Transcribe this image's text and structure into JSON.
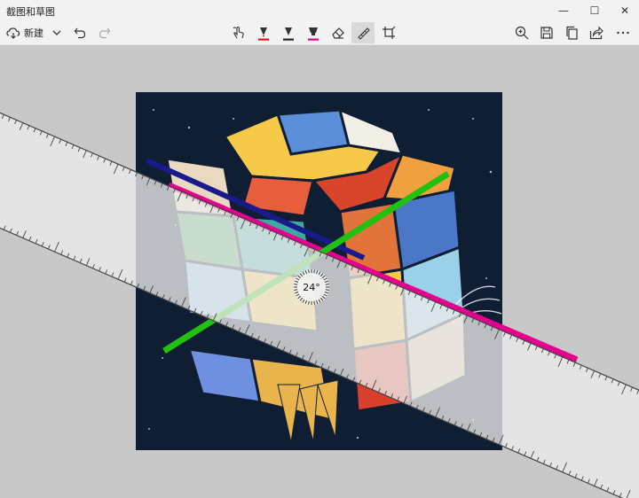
{
  "app": {
    "title": "截图和草图"
  },
  "window_controls": {
    "minimize": "—",
    "maximize": "☐",
    "close": "✕"
  },
  "toolbar": {
    "new_label": "新建",
    "icons": [
      "new-icon",
      "chevron-down-icon",
      "undo-icon",
      "redo-icon",
      "touch-writing-icon",
      "ballpoint-pen-icon",
      "pencil-icon",
      "highlighter-icon",
      "eraser-icon",
      "ruler-icon",
      "crop-icon",
      "zoom-icon",
      "save-icon",
      "copy-icon",
      "share-icon",
      "more-icon"
    ]
  },
  "ruler": {
    "angle_label": "24°",
    "angle_degrees": 24
  },
  "colors": {
    "pen_red": "#e81123",
    "pencil_black": "#222222",
    "highlighter_magenta": "#e3008c",
    "ink_blue": "#1a1a8c",
    "ink_green": "#22c010"
  }
}
